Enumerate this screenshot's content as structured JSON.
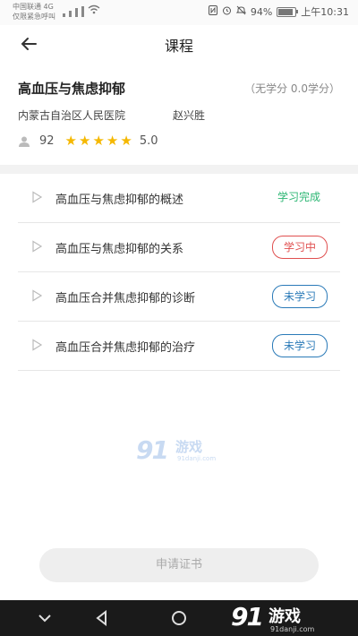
{
  "status_bar": {
    "carrier_line1": "中国联通 4G",
    "carrier_line2": "仅限紧急呼叫",
    "battery": "94%",
    "time": "上午10:31"
  },
  "header": {
    "title": "课程"
  },
  "course": {
    "name": "高血压与焦虑抑郁",
    "credit": "（无学分 0.0学分）",
    "hospital": "内蒙古自治区人民医院",
    "teacher": "赵兴胜",
    "learners": "92",
    "rating": "5.0",
    "stars": 5
  },
  "lessons": [
    {
      "title": "高血压与焦虑抑郁的概述",
      "status": "学习完成"
    },
    {
      "title": "高血压与焦虑抑郁的关系",
      "status": "学习中"
    },
    {
      "title": "高血压合并焦虑抑郁的诊断",
      "status": "未学习"
    },
    {
      "title": "高血压合并焦虑抑郁的治疗",
      "status": "未学习"
    }
  ],
  "apply_button": {
    "label": "申请证书"
  },
  "watermark": {
    "num": "91",
    "text": "游戏",
    "url": "91danji.com"
  },
  "brand": {
    "num": "91",
    "text": "游戏",
    "url": "91danji.com"
  },
  "colors": {
    "done": "#2bb673",
    "in_progress": "#e05050",
    "not_started": "#2a7ab8",
    "star": "#f5b800"
  }
}
